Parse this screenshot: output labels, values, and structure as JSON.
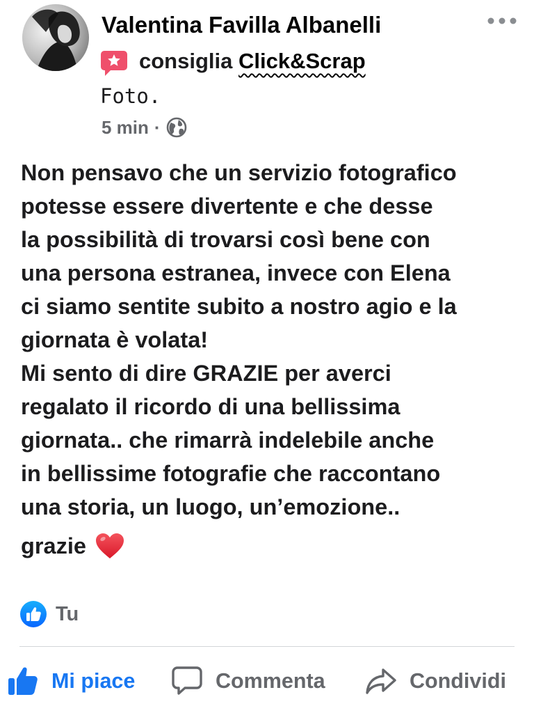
{
  "post": {
    "author": "Valentina Favilla Albanelli",
    "recommendation": {
      "verb": "consiglia",
      "page": "Click&Scrap"
    },
    "subtitle": "Foto.",
    "timestamp": "5 min",
    "separator": "·",
    "privacy_icon": "globe-icon",
    "text_paragraphs": [
      "Non pensavo che un servizio fotografico\npotesse essere divertente e che desse\nla possibilità di trovarsi così bene con\nuna persona estranea, invece con Elena\nci siamo sentite subito a nostro agio e la\ngiornata è volata!",
      "Mi sento di dire GRAZIE per averci\nregalato il ricordo di una bellissima\ngiornata.. che rimarrà indelebile anche\nin bellissime fotografie che raccontano\nuna storia, un luogo, un’emozione.."
    ],
    "closing": "grazie",
    "closing_icon": "red-heart-icon"
  },
  "reactions": {
    "icon": "like-reaction-icon",
    "label": "Tu"
  },
  "actions": {
    "like": {
      "label": "Mi piace",
      "icon": "thumbs-up-icon",
      "active": true
    },
    "comment": {
      "label": "Commenta",
      "icon": "comment-icon"
    },
    "share": {
      "label": "Condividi",
      "icon": "share-arrow-icon"
    }
  },
  "colors": {
    "accent_blue": "#1877f2",
    "secondary_text": "#65676b",
    "primary_text": "#1c1c1e",
    "recommend_pink": "#ef4f6b",
    "heart_red": "#e52a36"
  }
}
